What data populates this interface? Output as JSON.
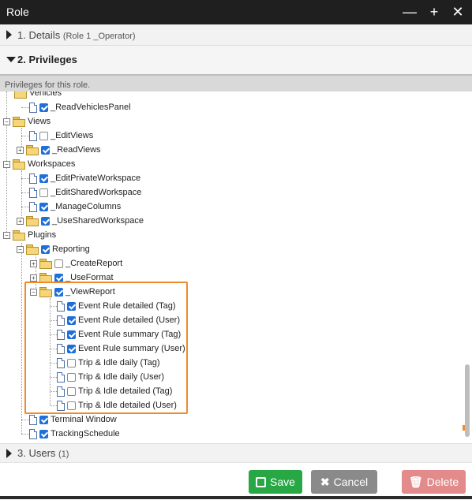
{
  "window": {
    "title": "Role"
  },
  "sections": {
    "details": {
      "label": "1. Details",
      "sub": "(Role 1 _Operator)"
    },
    "privileges": {
      "label": "2. Privileges",
      "description": "Privileges for this role."
    },
    "users": {
      "label": "3. Users",
      "sub": "(1)"
    }
  },
  "tree": {
    "vehicles": "Vehicles",
    "read_vehicles_panel": "_ReadVehiclesPanel",
    "views": "Views",
    "edit_views": "_EditViews",
    "read_views": "_ReadViews",
    "workspaces": "Workspaces",
    "edit_private_workspace": "_EditPrivateWorkspace",
    "edit_shared_workspace": "_EditSharedWorkspace",
    "manage_columns": "_ManageColumns",
    "use_shared_workspace": "_UseSharedWorkspace",
    "plugins": "Plugins",
    "reporting": "Reporting",
    "create_report": "_CreateReport",
    "use_format": "_UseFormat",
    "view_report": "_ViewReport",
    "reports": [
      {
        "label": "Event Rule detailed (Tag)",
        "checked": true
      },
      {
        "label": "Event Rule detailed (User)",
        "checked": true
      },
      {
        "label": "Event Rule summary (Tag)",
        "checked": true
      },
      {
        "label": "Event Rule summary (User)",
        "checked": true
      },
      {
        "label": "Trip & Idle daily (Tag)",
        "checked": false
      },
      {
        "label": "Trip & Idle daily (User)",
        "checked": false
      },
      {
        "label": "Trip & Idle detailed (Tag)",
        "checked": false
      },
      {
        "label": "Trip & Idle detailed (User)",
        "checked": false
      }
    ],
    "terminal_window": "Terminal Window",
    "tracking_schedule": "TrackingSchedule"
  },
  "footer": {
    "save": "Save",
    "cancel": "Cancel",
    "delete": "Delete"
  },
  "colors": {
    "save": "#28a745",
    "cancel": "#8a8a8a",
    "delete": "#e38a8a",
    "highlight": "#f08a2b",
    "checkbox": "#1e6fd9"
  }
}
